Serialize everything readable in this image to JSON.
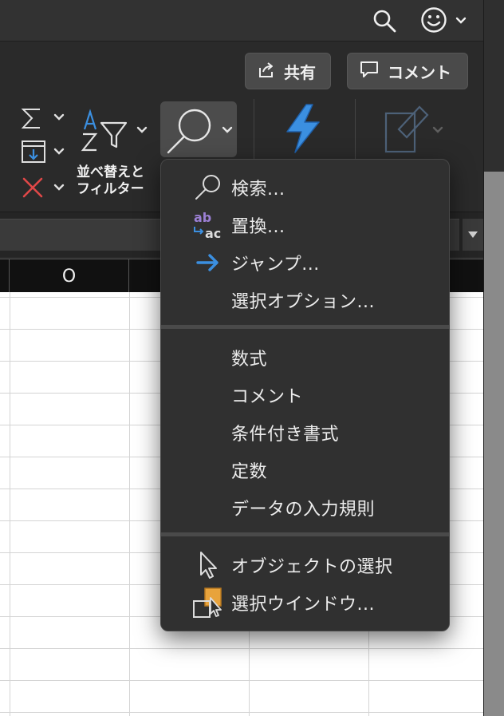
{
  "titlebar": {
    "search_icon": "search-icon",
    "feedback_icon": "smiley-icon"
  },
  "ribbon": {
    "share_label": "共有",
    "comment_label": "コメント",
    "sort_filter_label_line1": "並べ替えと",
    "sort_filter_label_line2": "フィルター",
    "find_select_icon": "magnifier-icon",
    "ideas_icon": "lightning-icon"
  },
  "sheet": {
    "column_header": "O"
  },
  "find_menu": {
    "items_top": [
      {
        "label": "検索...",
        "icon": "magnifier-icon"
      },
      {
        "label": "置換...",
        "icon": "replace-icon"
      },
      {
        "label": "ジャンプ...",
        "icon": "arrow-right-icon"
      },
      {
        "label": "選択オプション...",
        "icon": ""
      }
    ],
    "items_middle": [
      {
        "label": "数式"
      },
      {
        "label": "コメント"
      },
      {
        "label": "条件付き書式"
      },
      {
        "label": "定数"
      },
      {
        "label": "データの入力規則"
      }
    ],
    "items_bottom": [
      {
        "label": "オブジェクトの選択",
        "icon": "pointer-icon"
      },
      {
        "label": "選択ウインドウ...",
        "icon": "selection-pane-icon"
      }
    ]
  },
  "colors": {
    "accent_blue": "#3b8fe0",
    "replace_purple": "#9b7fd4",
    "selection_orange": "#e8a33c"
  }
}
